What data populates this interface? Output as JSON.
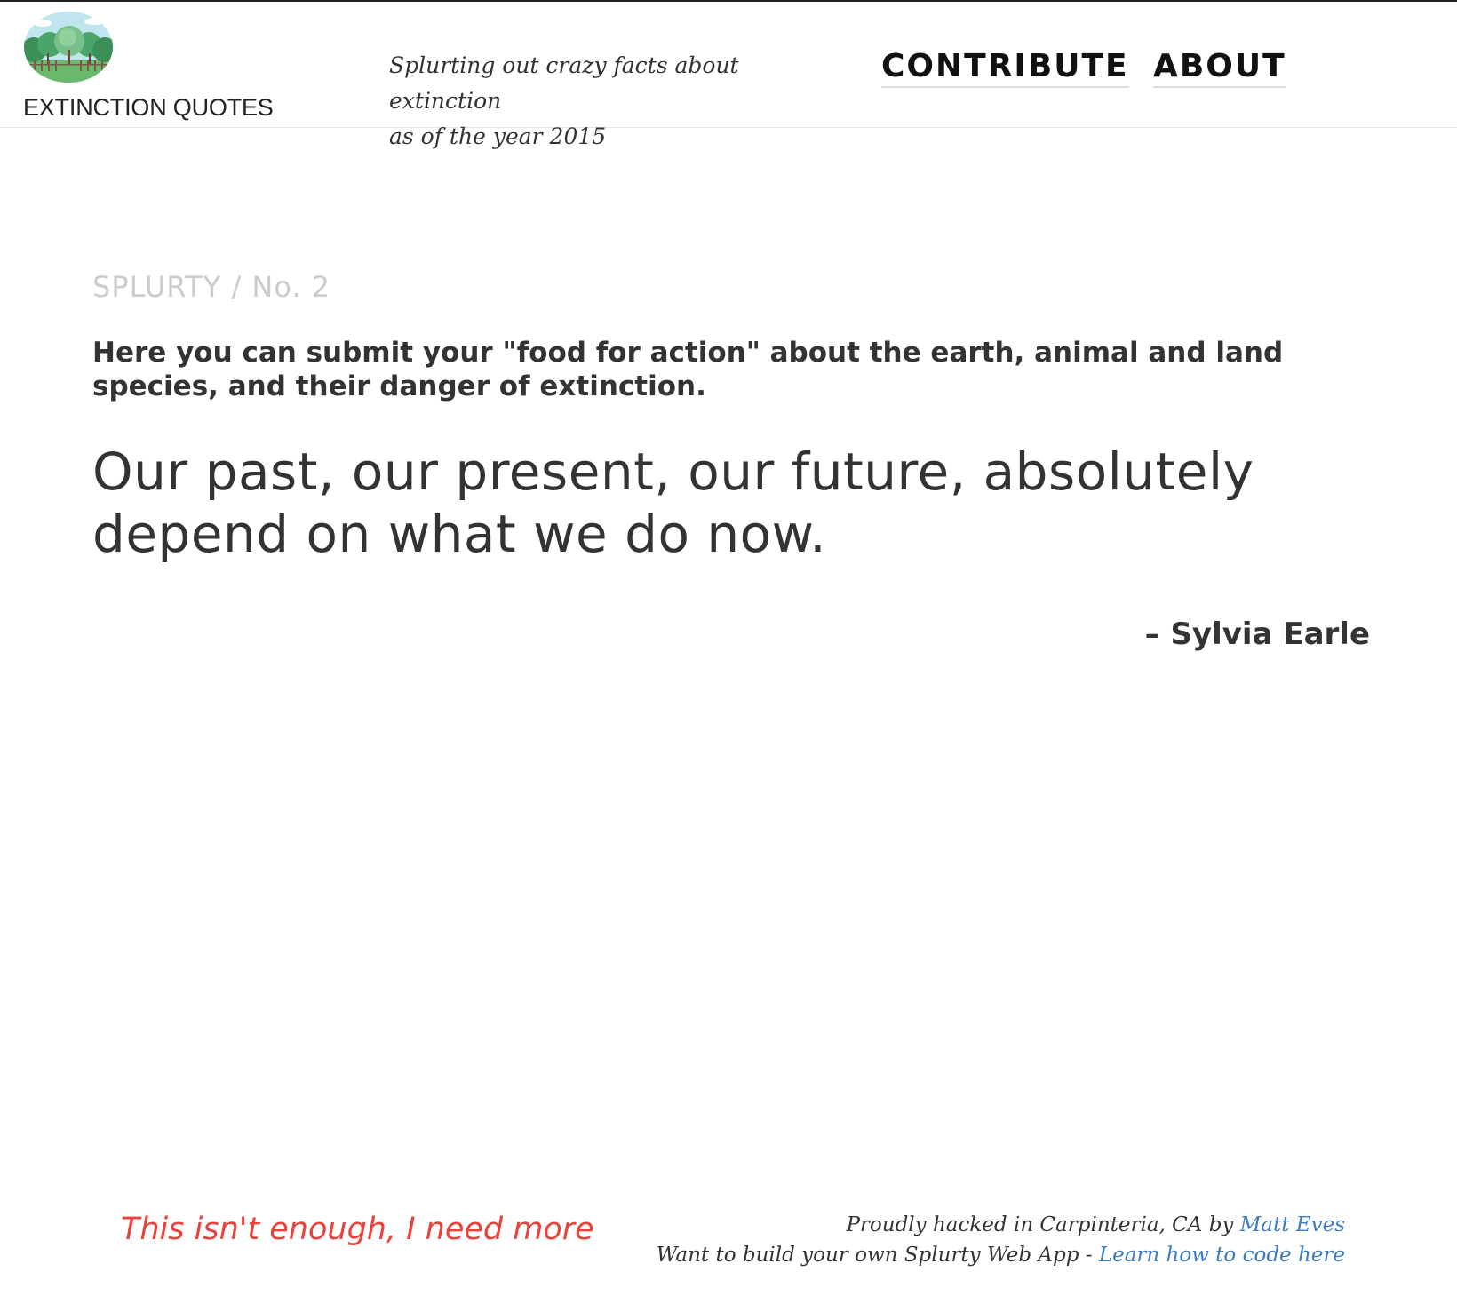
{
  "header": {
    "logo_text": "EXTINCTION QUOTES",
    "tagline_line1": "Splurting out crazy facts about extinction",
    "tagline_line2": "as of the year 2015",
    "nav": {
      "contribute": "CONTRIBUTE",
      "about": "ABOUT"
    }
  },
  "main": {
    "kicker": "SPLURTY / No. 2",
    "intro": "Here you can submit your \"food for action\" about the earth, animal and land species, and their danger of extinction.",
    "quote": "Our past, our present, our future, absolutely depend on what we do now.",
    "author": "– Sylvia Earle"
  },
  "footer": {
    "more_link": "This isn't enough, I need more",
    "credit_prefix": "Proudly hacked in Carpinteria, CA by",
    "credit_author": "Matt Eves",
    "build_prefix": "Want to build your own Splurty Web App -",
    "build_link": "Learn how to code here"
  },
  "colors": {
    "accent_red": "#e8423a",
    "link_blue": "#3b7cc4",
    "kicker_gray": "#cccccc",
    "text_dark": "#333333"
  },
  "icons": {
    "logo": "forest-logo-icon"
  }
}
